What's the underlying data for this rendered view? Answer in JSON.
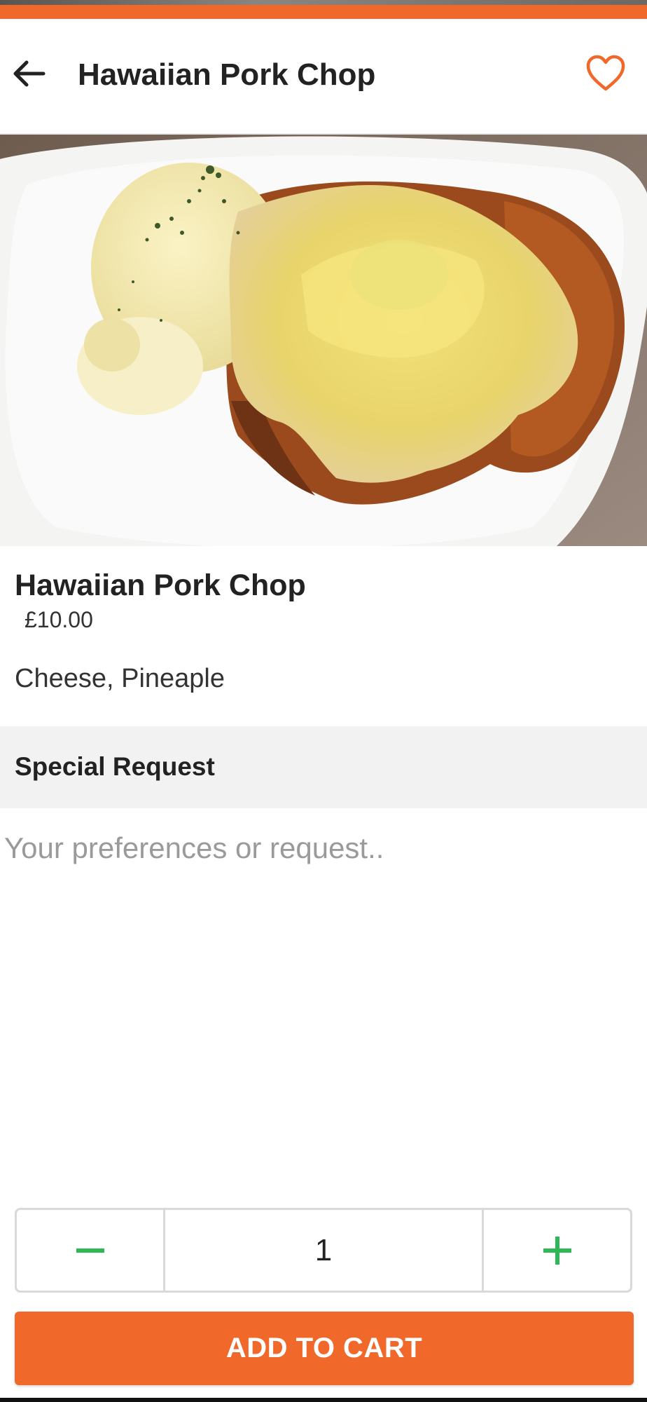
{
  "header": {
    "title": "Hawaiian Pork Chop",
    "back_icon": "arrow-left-icon",
    "favorite_icon": "heart-outline-icon"
  },
  "item": {
    "name": "Hawaiian Pork Chop",
    "price": "£10.00",
    "description": "Cheese, Pineaple"
  },
  "special_request": {
    "title": "Special Request",
    "placeholder": "Your preferences or request.."
  },
  "quantity": {
    "value": "1",
    "decrement_icon": "minus-icon",
    "increment_icon": "plus-icon"
  },
  "cart": {
    "button_label": "ADD TO CART"
  },
  "colors": {
    "accent": "#f0682a",
    "stepper_icon": "#2eb855",
    "section_bg": "#f2f2f2"
  }
}
